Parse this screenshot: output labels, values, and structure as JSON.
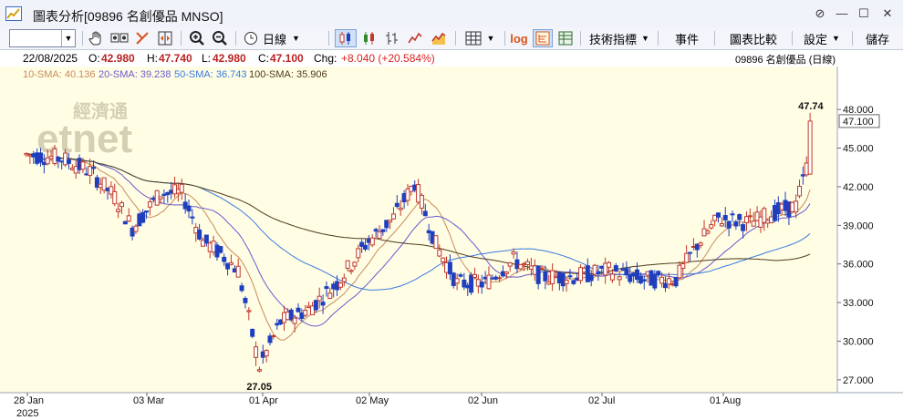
{
  "window": {
    "title": "圖表分析[09896 名創優品 MNSO]",
    "buttons": [
      "⊘",
      "—",
      "☐",
      "✕"
    ]
  },
  "toolbar": {
    "period_label": "日線",
    "indicators_label": "技術指標",
    "events_label": "事件",
    "compare_label": "圖表比較",
    "settings_label": "設定",
    "save_label": "儲存",
    "log_label": "log"
  },
  "info": {
    "date": "22/08/2025",
    "open_label": "O:",
    "open": "42.980",
    "high_label": "H:",
    "high": "47.740",
    "low_label": "L:",
    "low": "42.980",
    "close_label": "C:",
    "close": "47.100",
    "chg_label": "Chg:",
    "chg": "+8.040 (+20.584%)",
    "stock_label": "09896  名創優品 (日線)"
  },
  "sma": {
    "sma10": "10-SMA: 40.136",
    "sma20": "20-SMA: 39.238",
    "sma50": "50-SMA: 36.743",
    "sma100": "100-SMA: 35.906"
  },
  "colors": {
    "up": "#c0392b",
    "down": "#1f3fbf",
    "sma10": "#c98a5a",
    "sma20": "#6a5acd",
    "sma50": "#3a7be0",
    "sma100": "#4d3b1f"
  },
  "chart_data": {
    "type": "candlestick",
    "y_ticks": [
      "48.000",
      "45.000",
      "42.000",
      "39.000",
      "36.000",
      "33.000",
      "30.000",
      "27.000"
    ],
    "ylim": [
      26,
      49.5
    ],
    "x_ticks": [
      "28 Jan",
      "03 Mar",
      "01 Apr",
      "02 May",
      "02 Jun",
      "02 Jul",
      "01 Aug"
    ],
    "x_year": "2025",
    "last_price": "47.100",
    "high_marker": "47.74",
    "low_marker": "27.05",
    "watermark": "經濟通",
    "watermark2": "etnet"
  }
}
